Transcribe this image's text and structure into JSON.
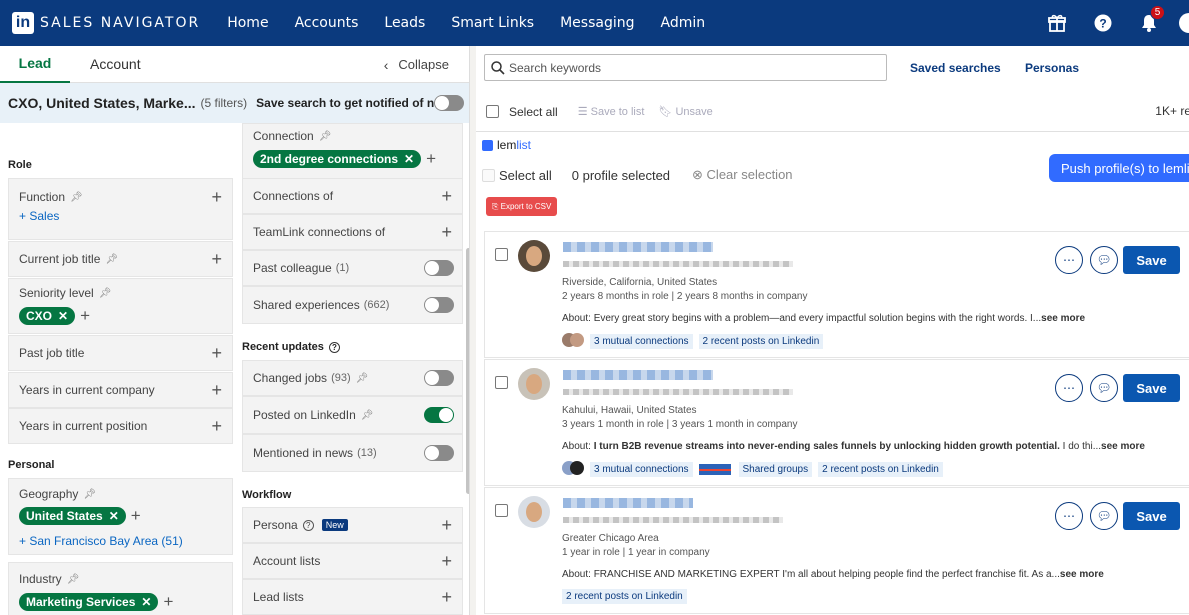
{
  "nav": {
    "logo_in": "in",
    "logo_text": "SALES NAVIGATOR",
    "items": [
      "Home",
      "Accounts",
      "Leads",
      "Smart Links",
      "Messaging",
      "Admin"
    ],
    "notification_count": "5",
    "bg": "#0b3a7e"
  },
  "left": {
    "tabs": {
      "lead": "Lead",
      "account": "Account"
    },
    "collapse": "Collapse",
    "filter_summary": "CXO, United States, Marke...",
    "filter_count": "(5 filters)",
    "save_search": "Save search to get notified of ne...",
    "sections": {
      "role": "Role",
      "personal": "Personal",
      "recent_updates": "Recent updates",
      "workflow": "Workflow"
    },
    "col1": {
      "function": "Function",
      "function_link": "Sales",
      "current_job_title": "Current job title",
      "seniority": "Seniority level",
      "seniority_chip": "CXO",
      "past_job_title": "Past job title",
      "years_company": "Years in current company",
      "years_position": "Years in current position",
      "geography": "Geography",
      "geo_chip": "United States",
      "geo_link": "San Francisco Bay Area (51)",
      "industry": "Industry",
      "industry_chip": "Marketing Services"
    },
    "col2": {
      "connection": "Connection",
      "connection_chip": "2nd degree connections",
      "connections_of": "Connections of",
      "teamlink": "TeamLink connections of",
      "past_colleague": "Past colleague",
      "past_colleague_count": "(1)",
      "shared_exp": "Shared experiences",
      "shared_exp_count": "(662)",
      "changed_jobs": "Changed jobs",
      "changed_jobs_count": "(93)",
      "posted": "Posted on LinkedIn",
      "mentioned": "Mentioned in news",
      "mentioned_count": "(13)",
      "persona": "Persona",
      "persona_badge": "New",
      "account_lists": "Account lists",
      "lead_lists": "Lead lists"
    },
    "accent": "#057642"
  },
  "right": {
    "search_placeholder": "Search keywords",
    "saved_searches": "Saved searches",
    "personas": "Personas",
    "select_all": "Select all",
    "save_to_list": "Save to list",
    "unsave": "Unsave",
    "results_count": "1K+ re",
    "lemlist": {
      "brand_a": "lem",
      "brand_b": "list",
      "select_all": "Select all",
      "selected": "0 profile selected",
      "clear": "Clear selection",
      "push": "Push profile(s) to lemli",
      "export": "Export to CSV"
    },
    "results": [
      {
        "location": "Riverside, California, United States",
        "tenure": "2 years 8 months in role | 2 years 8 months in company",
        "about_label": "About:",
        "about": " Every great story begins with a problem—and every impactful solution begins with the right words. I...",
        "see_more": "see more",
        "tags": [
          "3 mutual connections",
          "2 recent posts on Linkedin"
        ],
        "save": "Save"
      },
      {
        "location": "Kahului, Hawaii, United States",
        "tenure": "3 years 1 month in role | 3 years 1 month in company",
        "about_label": "About:",
        "about": " I turn B2B revenue streams into never-ending sales funnels by unlocking hidden growth potential.",
        "about_tail": " I do thi...",
        "see_more": "see more",
        "tags": [
          "3 mutual connections",
          "Shared groups",
          "2 recent posts on Linkedin"
        ],
        "save": "Save"
      },
      {
        "location": "Greater Chicago Area",
        "tenure": "1 year in role | 1 year in company",
        "about_label": "About:",
        "about": " FRANCHISE AND MARKETING EXPERT I'm all about helping people find the perfect franchise fit. As a...",
        "see_more": "see more",
        "tags": [
          "2 recent posts on Linkedin"
        ],
        "save": "Save"
      }
    ]
  }
}
